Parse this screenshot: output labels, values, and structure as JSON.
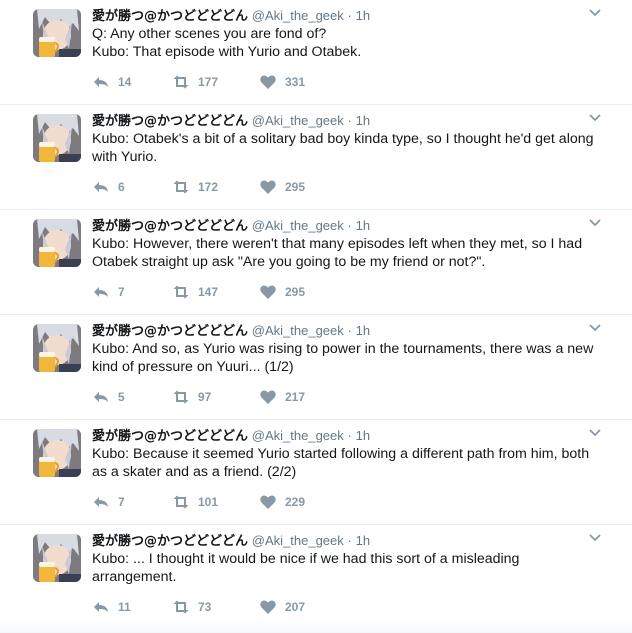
{
  "colors": {
    "text": "#14171a",
    "secondary": "#657786",
    "icon": "#8899a6",
    "divider": "#e6ecf0"
  },
  "icons": {
    "reply": "reply-icon",
    "retweet": "retweet-icon",
    "like": "heart-icon",
    "menu": "chevron-down-icon"
  },
  "tweets": [
    {
      "name": "愛が勝つ@かつどどどどん",
      "handle": "@Aki_the_geek",
      "dot": "·",
      "time": "1h",
      "lines": [
        "Q: Any other scenes you are fond of?",
        "Kubo: That episode with Yurio and Otabek."
      ],
      "replies": "14",
      "retweets": "177",
      "likes": "331"
    },
    {
      "name": "愛が勝つ@かつどどどどん",
      "handle": "@Aki_the_geek",
      "dot": "·",
      "time": "1h",
      "lines": [
        "Kubo: Otabek's a bit of a solitary bad boy kinda type, so I thought he'd get along",
        "with Yurio."
      ],
      "replies": "6",
      "retweets": "172",
      "likes": "295"
    },
    {
      "name": "愛が勝つ@かつどどどどん",
      "handle": "@Aki_the_geek",
      "dot": "·",
      "time": "1h",
      "lines": [
        "Kubo: However, there weren't that many episodes left when they met, so I had",
        "Otabek straight up ask \"Are you going to be my friend or not?\"."
      ],
      "replies": "7",
      "retweets": "147",
      "likes": "295"
    },
    {
      "name": "愛が勝つ@かつどどどどん",
      "handle": "@Aki_the_geek",
      "dot": "·",
      "time": "1h",
      "lines": [
        "Kubo: And so, as Yurio was rising to power in the tournaments, there was a new",
        "kind of pressure on Yuuri... (1/2)"
      ],
      "replies": "5",
      "retweets": "97",
      "likes": "217"
    },
    {
      "name": "愛が勝つ@かつどどどどん",
      "handle": "@Aki_the_geek",
      "dot": "·",
      "time": "1h",
      "lines": [
        "Kubo: Because it seemed Yurio started following a different path from him, both",
        "as a skater and as a friend. (2/2)"
      ],
      "replies": "7",
      "retweets": "101",
      "likes": "229"
    },
    {
      "name": "愛が勝つ@かつどどどどん",
      "handle": "@Aki_the_geek",
      "dot": "·",
      "time": "1h",
      "lines": [
        "Kubo: ... I thought it would be nice if we had this sort of a misleading",
        "arrangement."
      ],
      "replies": "11",
      "retweets": "73",
      "likes": "207"
    }
  ]
}
